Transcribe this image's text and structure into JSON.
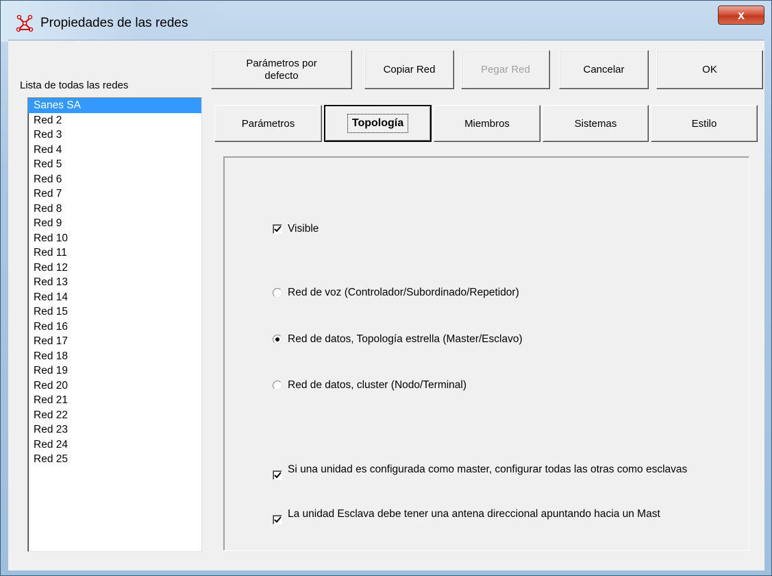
{
  "window": {
    "title": "Propiedades de las redes",
    "close_label": "x"
  },
  "list": {
    "caption": "Lista de todas las redes",
    "items": [
      "Sanes SA",
      "Red  2",
      "Red  3",
      "Red  4",
      "Red  5",
      "Red  6",
      "Red  7",
      "Red  8",
      "Red  9",
      "Red 10",
      "Red 11",
      "Red 12",
      "Red 13",
      "Red 14",
      "Red 15",
      "Red 16",
      "Red 17",
      "Red 18",
      "Red 19",
      "Red 20",
      "Red 21",
      "Red 22",
      "Red 23",
      "Red 24",
      "Red 25"
    ],
    "selected_index": 0
  },
  "toolbar": {
    "defaults_label": "Parámetros por defecto",
    "copy_label": "Copiar Red",
    "paste_label": "Pegar Red",
    "cancel_label": "Cancelar",
    "ok_label": "OK"
  },
  "tabs": [
    {
      "label": "Parámetros",
      "active": false
    },
    {
      "label": "Topología",
      "active": true
    },
    {
      "label": "Miembros",
      "active": false
    },
    {
      "label": "Sistemas",
      "active": false
    },
    {
      "label": "Estilo",
      "active": false
    }
  ],
  "topology": {
    "visible_label": "Visible",
    "visible_checked": true,
    "radio_voice_label": "Red de voz (Controlador/Subordinado/Repetidor)",
    "radio_star_label": "Red de datos, Topología estrella (Master/Esclavo)",
    "radio_cluster_label": "Red de datos, cluster (Nodo/Terminal)",
    "selected_radio": "star",
    "master_slaves_label": "Si una unidad es configurada como master, configurar todas las otras como esclavas",
    "master_slaves_checked": true,
    "slave_antenna_label": "La unidad Esclava debe tener una antena direccional apuntando hacia un Mast",
    "slave_antenna_checked": true
  },
  "colors": {
    "selection": "#3399ff",
    "face": "#f0f0f0",
    "close_button": "#c23a22"
  }
}
